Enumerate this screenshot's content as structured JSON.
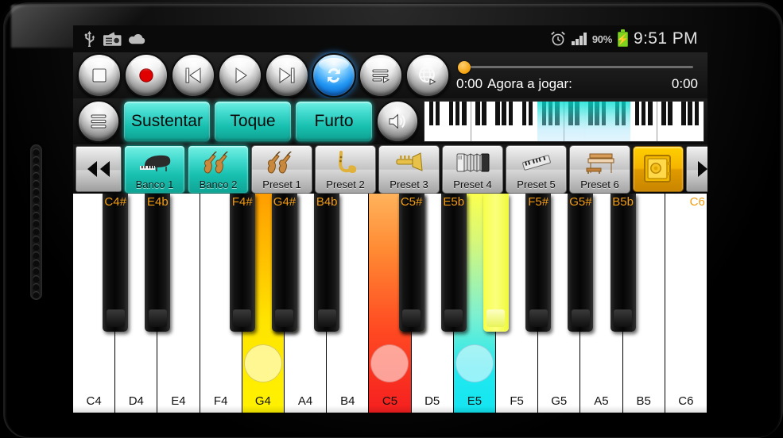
{
  "status_bar": {
    "left_icons": [
      "usb-icon",
      "radio-icon",
      "cloud-icon"
    ],
    "alarm_icon": "alarm-clock-icon",
    "signal_icon": "signal-bars-icon",
    "battery_percent": "90%",
    "battery_icon": "charging-battery-icon",
    "time": "9:51 PM"
  },
  "transport": {
    "buttons": [
      {
        "name": "stop-button",
        "icon": "stop-icon",
        "active": false
      },
      {
        "name": "record-button",
        "icon": "record-icon",
        "active": false
      },
      {
        "name": "previous-button",
        "icon": "skip-previous-icon",
        "active": false
      },
      {
        "name": "play-button",
        "icon": "play-icon",
        "active": false
      },
      {
        "name": "next-button",
        "icon": "skip-next-icon",
        "active": false
      },
      {
        "name": "loop-button",
        "icon": "loop-repeat-icon",
        "active": true
      },
      {
        "name": "playlist-button",
        "icon": "playlist-play-icon",
        "active": false
      },
      {
        "name": "globe-button",
        "icon": "globe-icon",
        "active": false
      }
    ]
  },
  "timeline": {
    "elapsed": "0:00",
    "now_playing_label": "Agora a jogar:",
    "total": "0:00",
    "progress_percent": 0,
    "thumb_color": "#f5a20a"
  },
  "mode_row": {
    "menu_icon": "hamburger-menu-icon",
    "buttons": [
      {
        "label": "Sustentar",
        "active": true
      },
      {
        "label": "Toque",
        "active": true
      },
      {
        "label": "Furto",
        "active": true
      }
    ],
    "volume_icon": "speaker-volume-icon",
    "accent_color": "#1fcfbe"
  },
  "mini_keyboard": {
    "total_white_keys": 42,
    "highlight_start_key": 17,
    "highlight_end_key": 31,
    "highlight_color": "#00e0d2"
  },
  "preset_row": {
    "prev_icon": "rewind-double-left-icon",
    "next_icon": "forward-double-right-icon",
    "vault_icon": "gold-safe-icon",
    "items": [
      {
        "label": "Banco 1",
        "icon": "grand-piano-icon",
        "active": true
      },
      {
        "label": "Banco 2",
        "icon": "violins-icon",
        "active": true
      },
      {
        "label": "Preset 1",
        "icon": "violins-icon",
        "active": false
      },
      {
        "label": "Preset 2",
        "icon": "saxophone-icon",
        "active": false
      },
      {
        "label": "Preset 3",
        "icon": "trumpet-icon",
        "active": false
      },
      {
        "label": "Preset 4",
        "icon": "accordion-icon",
        "active": false
      },
      {
        "label": "Preset 5",
        "icon": "synth-keyboard-icon",
        "active": false
      },
      {
        "label": "Preset 6",
        "icon": "organ-icon",
        "active": false
      }
    ]
  },
  "piano": {
    "white_keys": [
      {
        "label": "C4",
        "state": "normal"
      },
      {
        "label": "D4",
        "state": "normal"
      },
      {
        "label": "E4",
        "state": "normal"
      },
      {
        "label": "F4",
        "state": "normal"
      },
      {
        "label": "G4",
        "state": "pressed-yellow"
      },
      {
        "label": "A4",
        "state": "normal"
      },
      {
        "label": "B4",
        "state": "normal"
      },
      {
        "label": "C5",
        "state": "pressed-red"
      },
      {
        "label": "D5",
        "state": "normal"
      },
      {
        "label": "E5",
        "state": "pressed-cyan"
      },
      {
        "label": "F5",
        "state": "normal"
      },
      {
        "label": "G5",
        "state": "normal"
      },
      {
        "label": "A5",
        "state": "normal"
      },
      {
        "label": "B5",
        "state": "normal"
      },
      {
        "label": "C6",
        "state": "normal"
      }
    ],
    "black_keys": [
      {
        "label": "C4#",
        "after_white": 0,
        "state": "normal"
      },
      {
        "label": "E4b",
        "after_white": 1,
        "state": "normal"
      },
      {
        "label": "F4#",
        "after_white": 3,
        "state": "normal"
      },
      {
        "label": "",
        "after_white": 4,
        "state": "pressed-orange"
      },
      {
        "label": "G4#",
        "after_white": 4,
        "state": "normal"
      },
      {
        "label": "B4b",
        "after_white": 5,
        "state": "normal"
      },
      {
        "label": "",
        "after_white": 7,
        "state": "pressed-orange"
      },
      {
        "label": "C5#",
        "after_white": 7,
        "state": "normal"
      },
      {
        "label": "E5b",
        "after_white": 8,
        "state": "normal"
      },
      {
        "label": "",
        "after_white": 9,
        "state": "pressed-yellow"
      },
      {
        "label": "F5#",
        "after_white": 10,
        "state": "normal"
      },
      {
        "label": "G5#",
        "after_white": 11,
        "state": "normal"
      },
      {
        "label": "B5b",
        "after_white": 12,
        "state": "normal"
      },
      {
        "label": "C6",
        "after_white": 14,
        "state": "edge-label"
      }
    ],
    "label_color": "#f39c12"
  }
}
